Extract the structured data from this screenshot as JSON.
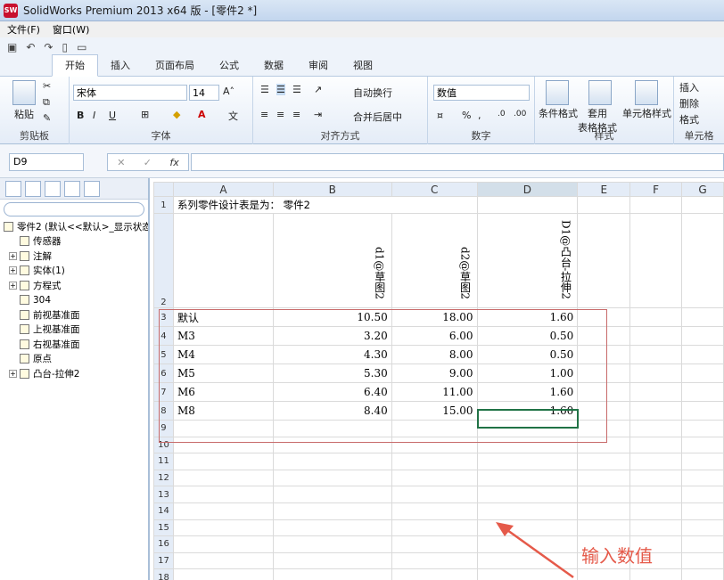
{
  "window": {
    "title": "SolidWorks Premium 2013 x64 版 - [零件2 *]",
    "logo": "SW"
  },
  "menu": [
    "文件(F)",
    "窗口(W)"
  ],
  "ribbon_tabs": [
    "开始",
    "插入",
    "页面布局",
    "公式",
    "数据",
    "审阅",
    "视图"
  ],
  "ribbon": {
    "clipboard": {
      "label": "剪贴板",
      "paste": "粘贴"
    },
    "font": {
      "label": "字体",
      "family": "宋体",
      "size": "14",
      "bold": "B",
      "italic": "I",
      "underline": "U"
    },
    "alignment": {
      "label": "对齐方式",
      "wrap": "自动换行",
      "merge": "合并后居中"
    },
    "number": {
      "label": "数字",
      "format": "数值",
      "percent": "%",
      "comma": ","
    },
    "styles": {
      "label": "样式",
      "conditional": "条件格式",
      "table_format": "套用\n表格格式",
      "cell_styles": "单元格样式"
    },
    "cells": {
      "label": "单元格",
      "insert": "插入",
      "delete": "删除",
      "format": "格式"
    }
  },
  "formula_bar": {
    "name_box": "D9",
    "cancel": "✕",
    "enter": "✓",
    "fx": "fx",
    "value": ""
  },
  "feature_tree": {
    "root": "零件2 (默认<<默认>_显示状态",
    "items": [
      {
        "label": "传感器",
        "expand": ""
      },
      {
        "label": "注解",
        "expand": "+"
      },
      {
        "label": "实体(1)",
        "expand": "+"
      },
      {
        "label": "方程式",
        "expand": "+"
      },
      {
        "label": "304",
        "expand": ""
      },
      {
        "label": "前视基准面",
        "expand": ""
      },
      {
        "label": "上视基准面",
        "expand": ""
      },
      {
        "label": "右视基准面",
        "expand": ""
      },
      {
        "label": "原点",
        "expand": ""
      },
      {
        "label": "凸台-拉伸2",
        "expand": "+"
      }
    ]
  },
  "sheet": {
    "columns": [
      "A",
      "B",
      "C",
      "D",
      "E",
      "F",
      "G"
    ],
    "title_cell": "系列零件设计表是为：  零件2",
    "headers": [
      "d1@草图2",
      "d2@草图2",
      "D1@凸台-拉伸2"
    ],
    "rows": [
      {
        "name": "默认",
        "b": "10.50",
        "c": "18.00",
        "d": "1.60"
      },
      {
        "name": "M3",
        "b": "3.20",
        "c": "6.00",
        "d": "0.50"
      },
      {
        "name": "M4",
        "b": "4.30",
        "c": "8.00",
        "d": "0.50"
      },
      {
        "name": "M5",
        "b": "5.30",
        "c": "9.00",
        "d": "1.00"
      },
      {
        "name": "M6",
        "b": "6.40",
        "c": "11.00",
        "d": "1.60"
      },
      {
        "name": "M8",
        "b": "8.40",
        "c": "15.00",
        "d": "1.60"
      }
    ],
    "empty_rows": [
      "9",
      "10",
      "11",
      "12",
      "13",
      "14",
      "15",
      "16",
      "17",
      "18"
    ]
  },
  "annotation": "输入数值",
  "colors": {
    "selection": "#217346",
    "annotation": "#e55a4a",
    "range_border": "#c86b6b"
  }
}
